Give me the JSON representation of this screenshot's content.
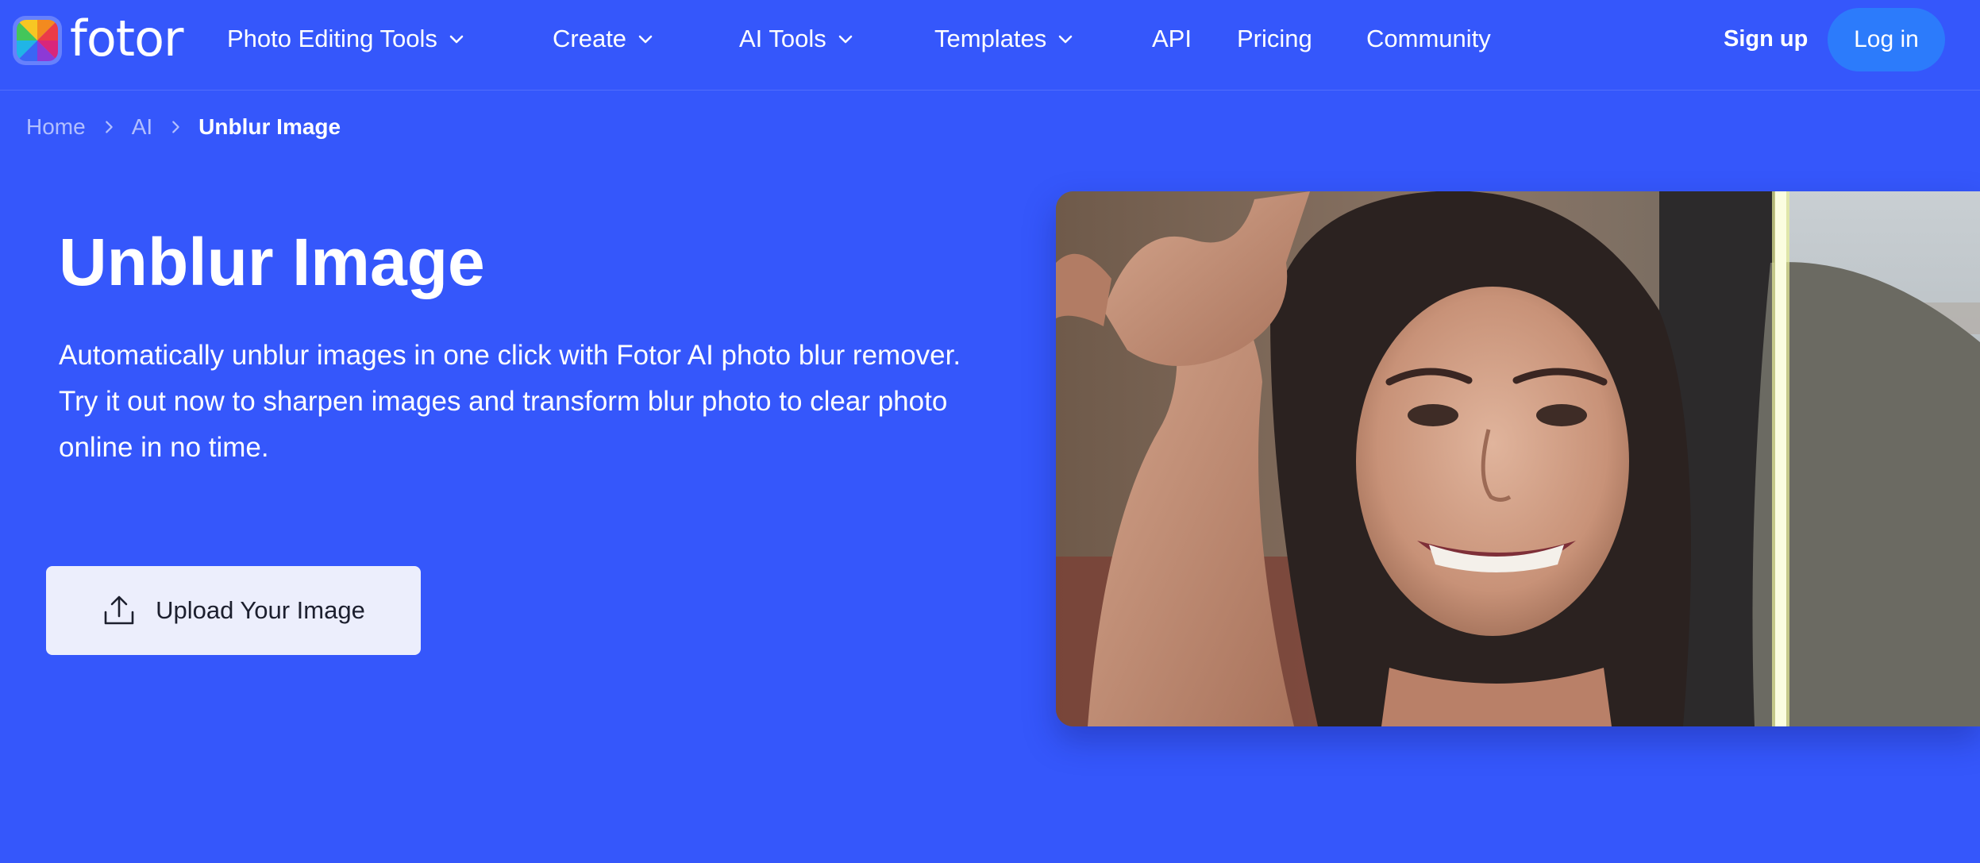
{
  "brand": {
    "name": "fotor"
  },
  "nav": {
    "items": [
      {
        "label": "Photo Editing Tools",
        "has_dropdown": true
      },
      {
        "label": "Create",
        "has_dropdown": true
      },
      {
        "label": "AI Tools",
        "has_dropdown": true
      },
      {
        "label": "Templates",
        "has_dropdown": true
      },
      {
        "label": "API",
        "has_dropdown": false
      },
      {
        "label": "Pricing",
        "has_dropdown": false
      },
      {
        "label": "Community",
        "has_dropdown": false
      }
    ],
    "signup_label": "Sign up",
    "login_label": "Log in"
  },
  "breadcrumb": {
    "home": "Home",
    "section": "AI",
    "current": "Unblur Image"
  },
  "hero": {
    "title": "Unblur Image",
    "description_line1": "Automatically unblur images in one click with Fotor AI photo blur remover.",
    "description_line2": "Try it out now to sharpen images and transform blur photo to clear photo online in no time.",
    "upload_label": "Upload Your Image"
  },
  "icons": {
    "logo": "fotor-logo-icon",
    "dropdown": "chevron-down-icon",
    "breadcrumb_separator": "chevron-right-icon",
    "upload": "upload-icon"
  },
  "colors": {
    "background": "#3557FB",
    "login_button": "#2C7BFB",
    "upload_button": "#ECEEFC",
    "upload_text": "#1C1F2E",
    "breadcrumb_link": "#A9B6FD"
  }
}
